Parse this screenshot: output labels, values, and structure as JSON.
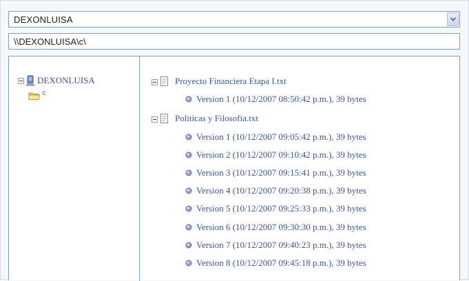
{
  "server_select": {
    "value": "DEXONLUISA"
  },
  "path_field": {
    "value": "\\\\DEXONLUISA\\c\\"
  },
  "tree": {
    "server_label": "DEXONLUISA",
    "folder_label": "c"
  },
  "files": [
    {
      "name": "Proyecto Financiera Etapa I.txt",
      "versions": [
        "Version 1 (10/12/2007 08:50:42 p.m.), 39 bytes"
      ]
    },
    {
      "name": "Politicas y Filosofia.txt",
      "versions": [
        "Version 1 (10/12/2007 09:05:42 p.m.), 39 bytes",
        "Version 2 (10/12/2007 09:10:42 p.m.), 39 bytes",
        "Version 3 (10/12/2007 09:15:41 p.m.), 39 bytes",
        "Version 4 (10/12/2007 09:20:38 p.m.), 39 bytes",
        "Version 5 (10/12/2007 09:25:33 p.m.), 39 bytes",
        "Version 6 (10/12/2007 09:30:30 p.m.), 39 bytes",
        "Version 7 (10/12/2007 09:40:23 p.m.), 39 bytes",
        "Version 8 (10/12/2007 09:45:18 p.m.), 39 bytes"
      ]
    }
  ],
  "colors": {
    "link": "#3b55a0",
    "border": "#7f9db9"
  },
  "icons": {
    "combo_button": "chevron-down-icon",
    "server": "server-icon",
    "folder": "folder-icon",
    "file": "text-file-icon",
    "version": "version-icon",
    "expander": "collapse-icon"
  }
}
